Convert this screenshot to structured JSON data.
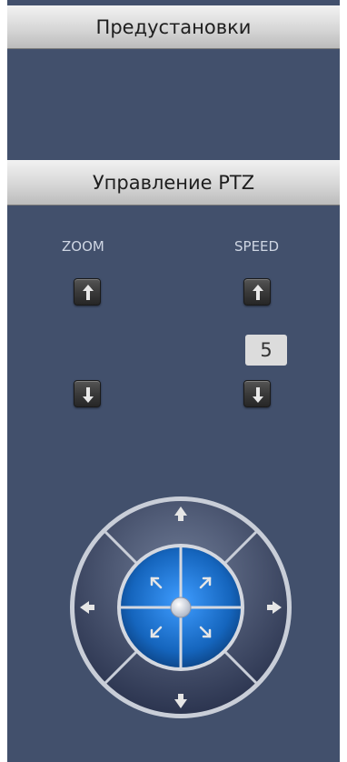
{
  "presets": {
    "title": "Предустановки"
  },
  "ptz": {
    "title": "Управление PTZ",
    "zoom_label": "ZOOM",
    "speed_label": "SPEED",
    "speed_value": "5"
  },
  "icons": {
    "zoom_in": "arrow-up-icon",
    "zoom_out": "arrow-down-icon",
    "speed_up": "arrow-up-icon",
    "speed_down": "arrow-down-icon",
    "joystick": [
      "arrow-up-icon",
      "arrow-down-icon",
      "arrow-left-icon",
      "arrow-right-icon",
      "arrow-up-left-icon",
      "arrow-up-right-icon",
      "arrow-down-left-icon",
      "arrow-down-right-icon"
    ]
  },
  "colors": {
    "panel_bg": "#42506c",
    "joystick_center": "#1f6fc4",
    "speed_box": "#dcdcdc"
  }
}
